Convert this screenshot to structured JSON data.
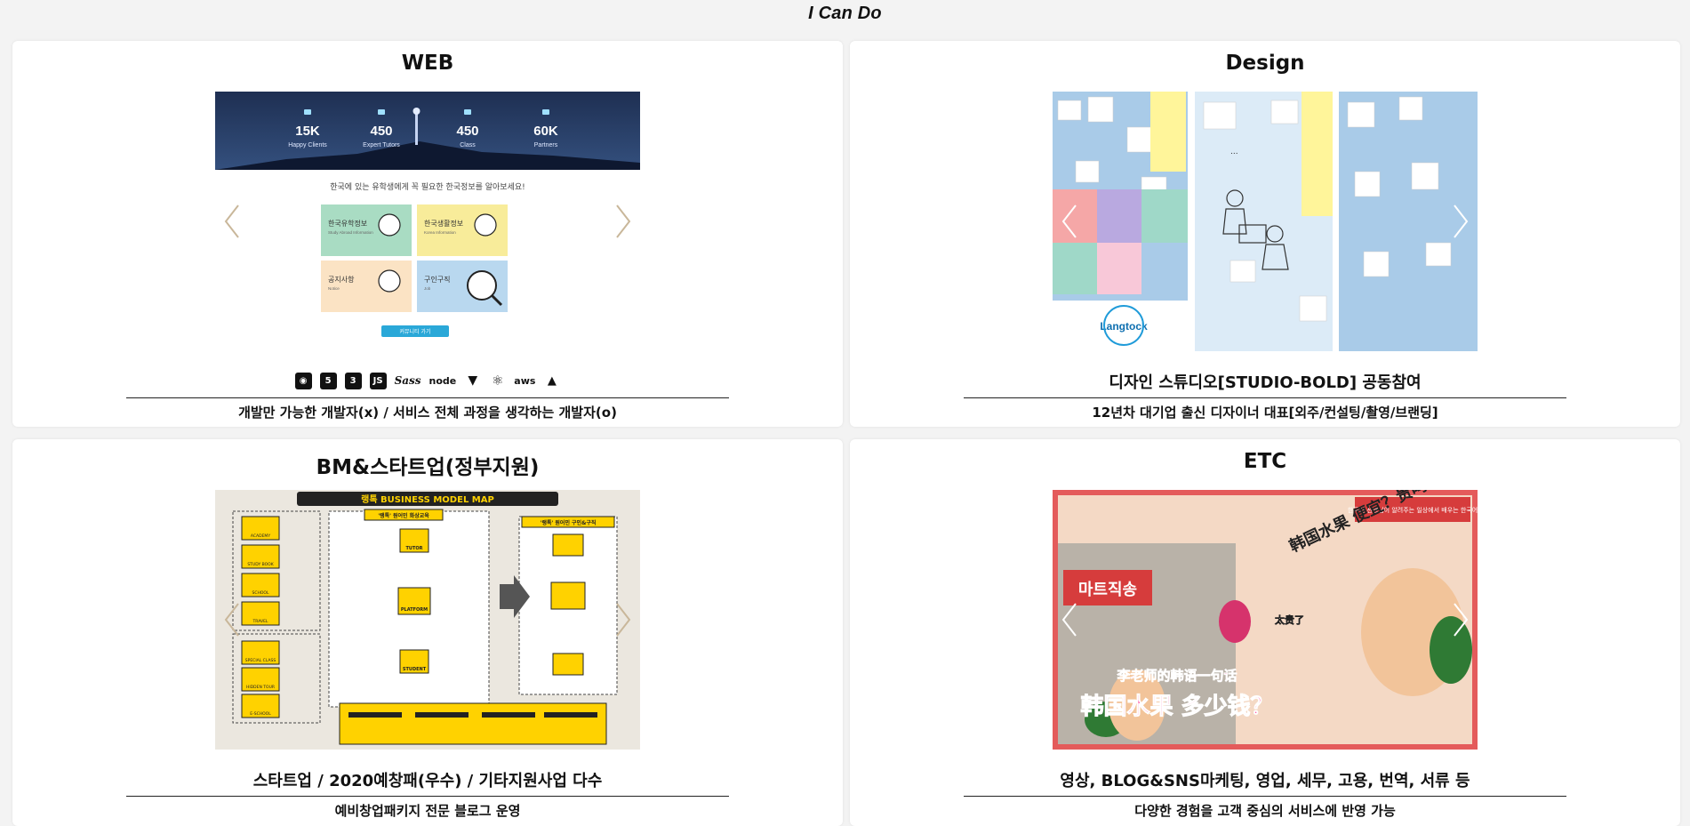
{
  "page": {
    "title": "I Can Do"
  },
  "cards": {
    "web": {
      "title": "WEB",
      "caption_tech_icons": [
        "github-icon",
        "html5-icon",
        "css3-icon",
        "javascript-icon",
        "sass-icon",
        "nodejs-icon",
        "vue-icon",
        "react-icon",
        "aws-icon",
        "firebase-icon"
      ],
      "description": "개발만 가능한 개발자(x) / 서비스 전체 과정을 생각하는 개발자(o)",
      "preview": {
        "stats": [
          {
            "value": "15K",
            "label": "Happy Clients"
          },
          {
            "value": "450",
            "label": "Expert Tutors"
          },
          {
            "value": "450",
            "label": "Class"
          },
          {
            "value": "60K",
            "label": "Partners"
          }
        ],
        "headline": "한국에 있는 유학생에게 꼭 필요한 한국정보를 알아보세요!",
        "tiles": [
          {
            "label": "한국유학정보",
            "sub": "Study Abroad Information",
            "color": "#a9dcc3"
          },
          {
            "label": "한국생활정보",
            "sub": "Korea Information",
            "color": "#f8ec9a"
          },
          {
            "label": "공지사항",
            "sub": "Notice",
            "color": "#fbe3c4"
          },
          {
            "label": "구인구직",
            "sub": "Job",
            "color": "#b9d8ef"
          }
        ],
        "button": "커뮤니티 가기"
      }
    },
    "design": {
      "title": "Design",
      "caption": "디자인 스튜디오[STUDIO-BOLD] 공동참여",
      "description": "12년차 대기업 출신 디자이너 대표[외주/컨설팅/촬영/브랜딩]",
      "preview": {
        "logo_text": "Langtock"
      }
    },
    "bm": {
      "title": "BM&스타트업(정부지원)",
      "caption": "스타트업 / 2020예창패(우수) / 기타지원사업 다수",
      "description": "예비창업패키지 전문 블로그 운영",
      "preview": {
        "map_title": "랭톡 BUSINESS MODEL MAP",
        "left_items": [
          "ACADEMY",
          "STUDY BOOK",
          "SCHOOL",
          "TRAVEL"
        ],
        "left_items_2": [
          "SPECIAL CLASS",
          "HIDDEN TOUR",
          "E-SCHOOL"
        ],
        "center_top": "'랭톡' 원어민 화상교육",
        "right_top": "'랭톡' 원어민 구인&구직",
        "nodes": [
          "TUTOR",
          "PLATFORM",
          "STUDENT"
        ]
      }
    },
    "etc": {
      "title": "ETC",
      "caption": "영상, BLOG&SNS마케팅, 영업, 세무, 고용, 번역, 서류 등",
      "description": "다양한 경험을 고객 중심의 서비스에 반영 가능",
      "preview": {
        "banner": "한국어 선생님이 알려주는 일상에서 배우는 한국어",
        "store_sign": "마트직송",
        "bubble_top": "韩国水果 便宜？贵吗？",
        "bubble_side": "太贵了",
        "headline_small": "李老师的韩语一句话",
        "headline_big": "韩国水果 多少钱？"
      }
    }
  },
  "colors": {
    "page_bg": "#f3f3f3",
    "card_bg": "#ffffff",
    "arrow": "#c9b79a",
    "web_night": "#1e2f52",
    "design_blue": "#a9cbe8",
    "bm_bg": "#ebe7df",
    "bm_yellow": "#ffd200",
    "etc_red": "#e45b5b"
  }
}
